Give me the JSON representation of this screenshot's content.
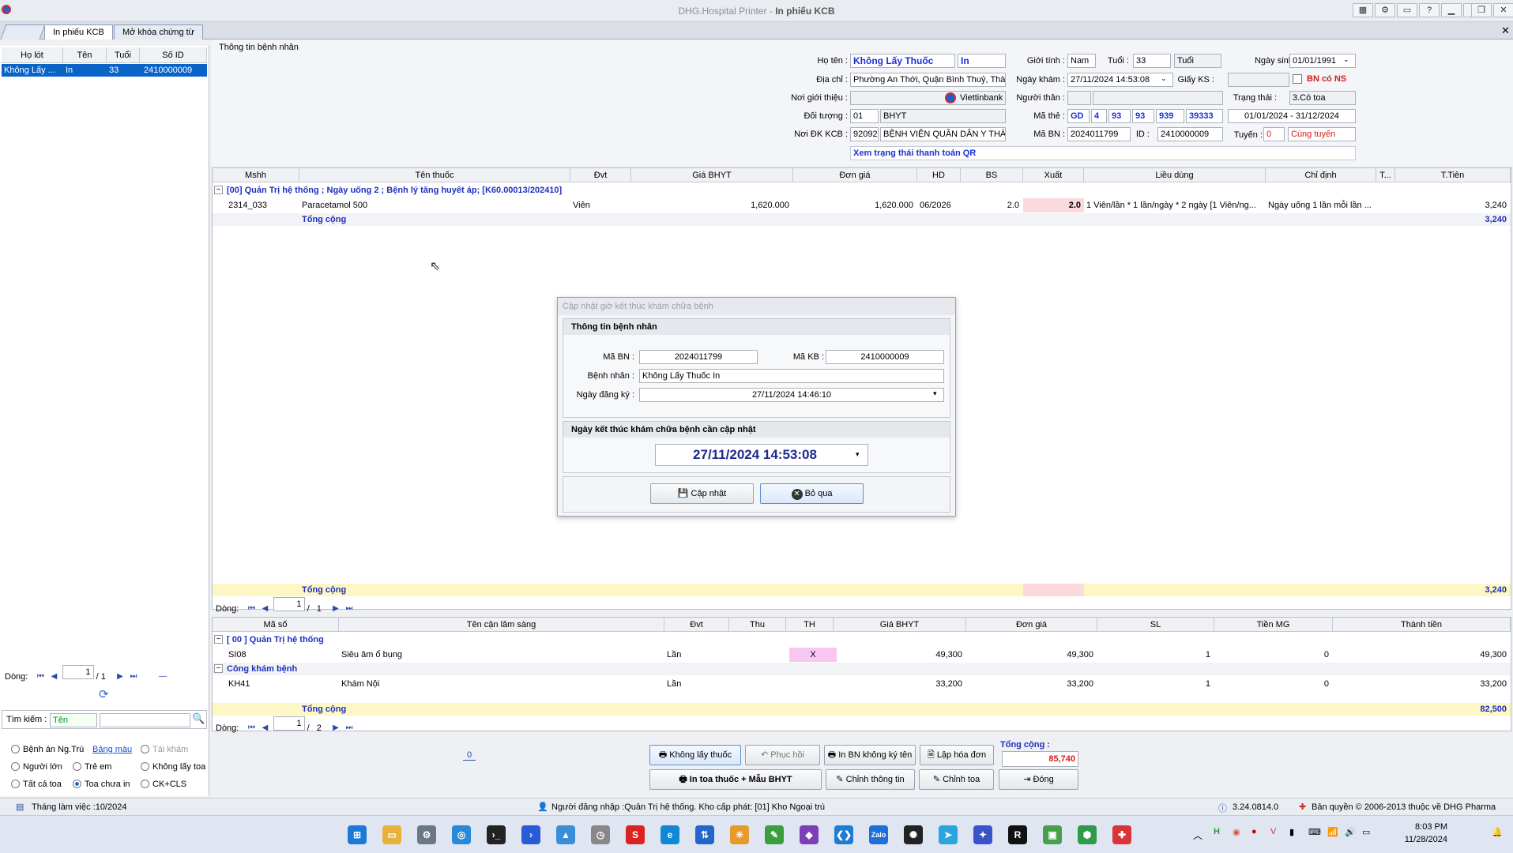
{
  "window": {
    "title_app": "DHG.Hospital Printer",
    "title_sep": " - ",
    "title_doc": "In phiếu KCB"
  },
  "tabs": [
    "In phiếu KCB",
    "Mở khóa chứng từ"
  ],
  "patient_list": {
    "columns": [
      "Họ lót",
      "Tên",
      "Tuổi",
      "Số ID"
    ],
    "rows": [
      {
        "holot": "Không Lấy ...",
        "ten": "In",
        "tuoi": "33",
        "soid": "2410000009"
      }
    ],
    "nav": {
      "label": "Dòng:",
      "page": "1",
      "sep": "/",
      "total": "1"
    },
    "search_label": "Tìm kiếm :",
    "search_field": "Tên",
    "options": {
      "r1": "Bệnh án Ng.Trú",
      "r1b": "Bảng màu",
      "r1c": "Tái khám",
      "r2": "Người lớn",
      "r2b": "Trẻ em",
      "r2c": "Không lấy toa",
      "r3": "Tất cả toa",
      "r3b": "Toa chưa in",
      "r3c": "CK+CLS"
    }
  },
  "patient_info": {
    "section_title": "Thông tin bệnh nhân",
    "ho_ten_lbl": "Họ tên :",
    "ho_ten": "Không Lấy Thuốc",
    "ten": "In",
    "gioi_tinh_lbl": "Giới tính :",
    "gioi_tinh": "Nam",
    "tuoi_lbl": "Tuổi :",
    "tuoi": "33",
    "tuoi_unit": "Tuổi",
    "ngay_sinh_lbl": "Ngày sinh :",
    "ngay_sinh": "01/01/1991",
    "dia_chi_lbl": "Địa chỉ :",
    "dia_chi": "Phường An Thới, Quận Bình Thuỷ, Thành",
    "ngay_kham_lbl": "Ngày khám :",
    "ngay_kham": "27/11/2024 14:53:08",
    "giay_ks_lbl": "Giấy KS :",
    "bn_co_ns": "BN có NS",
    "noi_gioi_thieu_lbl": "Nơi giới thiệu :",
    "bank": "Viettinbank",
    "nguoi_than_lbl": "Người thân :",
    "trang_thai_lbl": "Trạng thái :",
    "trang_thai": "3.Có toa",
    "doi_tuong_lbl": "Đối tượng :",
    "doi_tuong_code": "01",
    "doi_tuong": "BHYT",
    "ma_the_lbl": "Mã thẻ :",
    "ma_the": [
      "GD",
      "4",
      "93",
      "93",
      "939",
      "39333"
    ],
    "the_han": "01/01/2024 - 31/12/2024",
    "noi_dk_lbl": "Nơi ĐK KCB :",
    "noi_dk_code": "92092",
    "noi_dk": "BỆNH VIỆN QUÂN DÂN Y THÀ",
    "ma_bn_lbl": "Mã BN :",
    "ma_bn": "2024011799",
    "id_lbl": "ID :",
    "id": "2410000009",
    "tuyen_lbl": "Tuyến :",
    "tuyen_code": "0",
    "tuyen": "Cùng tuyến",
    "qr_link": "Xem trạng thái thanh toán QR"
  },
  "drug_grid": {
    "columns": [
      "Mshh",
      "Tên thuốc",
      "Đvt",
      "Giá BHYT",
      "Đơn giá",
      "HD",
      "BS",
      "Xuất",
      "Liều dùng",
      "Chỉ định",
      "T...",
      "T.Tiên"
    ],
    "group": "[00] Quản Trị hệ thống ; Ngày uống 2 ; Bệnh lý tăng huyết áp; [K60.00013/202410]",
    "rows": [
      {
        "mshh": "2314_033",
        "ten": "Paracetamol 500",
        "dvt": "Viên",
        "gia": "1,620.000",
        "dongia": "1,620.000",
        "hd": "06/2026",
        "bs": "2.0",
        "xuat": "2.0",
        "lieu": "1 Viên/lần * 1 lần/ngày * 2 ngày [1 Viên/ng...",
        "chidinh": "Ngày uống 1 lần mỗi lần ...",
        "ttien": "3,240"
      }
    ],
    "subtotal_lbl": "Tổng cộng",
    "subtotal": "3,240",
    "footer_lbl": "Tổng cộng",
    "footer_total": "3,240",
    "nav": {
      "label": "Dòng:",
      "page": "1",
      "sep": "/",
      "total": "1"
    }
  },
  "cls_grid": {
    "columns": [
      "Mã số",
      "Tên cận lâm sàng",
      "Đvt",
      "Thu",
      "TH",
      "Giá BHYT",
      "Đơn giá",
      "SL",
      "Tiền MG",
      "Thành tiền"
    ],
    "group1": "[ 00 ] Quản Trị hệ thống",
    "row1": {
      "ma": "SI08",
      "ten": "Siêu âm ổ bụng",
      "dvt": "Lần",
      "th": "X",
      "gia": "49,300",
      "dongia": "49,300",
      "sl": "1",
      "mg": "0",
      "tt": "49,300"
    },
    "group2": "Công khám bệnh",
    "row2": {
      "ma": "KH41",
      "ten": "Khám Nội",
      "dvt": "Lần",
      "gia": "33,200",
      "dongia": "33,200",
      "sl": "1",
      "mg": "0",
      "tt": "33,200"
    },
    "total_lbl": "Tổng cộng",
    "total": "82,500",
    "nav": {
      "label": "Dòng:",
      "page": "1",
      "sep": "/",
      "total": "2"
    }
  },
  "dialog": {
    "title": "Cập nhật giờ kết thúc khám chữa bệnh",
    "section1": "Thông tin bệnh nhân",
    "ma_bn_lbl": "Mã BN :",
    "ma_bn": "2024011799",
    "ma_kb_lbl": "Mã KB :",
    "ma_kb": "2410000009",
    "benh_nhan_lbl": "Bệnh nhân :",
    "benh_nhan": "Không Lấy Thuốc In",
    "ngay_dk_lbl": "Ngày đăng ký :",
    "ngay_dk": "27/11/2024 14:46:10",
    "section2": "Ngày kết thúc khám chữa bệnh cần cập nhật",
    "ngay_kt": "27/11/2024 14:53:08",
    "btn_update": "Cập nhật",
    "btn_skip": "Bỏ qua"
  },
  "bottom": {
    "counter": "0",
    "btn_khong_lay": "Không lấy thuốc",
    "btn_phuc_hoi": "Phục hồi",
    "btn_in_bn": "In BN không ký tên",
    "btn_lap_hd": "Lập hóa đơn",
    "btn_in_toa": "In toa thuốc + Mẫu BHYT",
    "btn_chinh_tt": "Chỉnh thông tin",
    "btn_chinh_toa": "Chỉnh toa",
    "btn_dong": "Đóng",
    "tong_cong_lbl": "Tổng cộng :",
    "tong_cong": "85,740"
  },
  "status": {
    "month": "Tháng làm việc :10/2024",
    "user": "Người đăng nhập :Quản Trị hệ thống. Kho cấp phát: [01] Kho Ngoại trú",
    "version": "3.24.0814.0",
    "copyright": "Bản quyền © 2006-2013 thuộc về DHG Pharma"
  },
  "taskbar": {
    "time": "8:03 PM",
    "date": "11/28/2024"
  },
  "colors": {
    "accent": "#0a64c8",
    "group_text": "#1f2fbf",
    "total_bg": "#fcf7c4",
    "red": "#d41c1c"
  }
}
